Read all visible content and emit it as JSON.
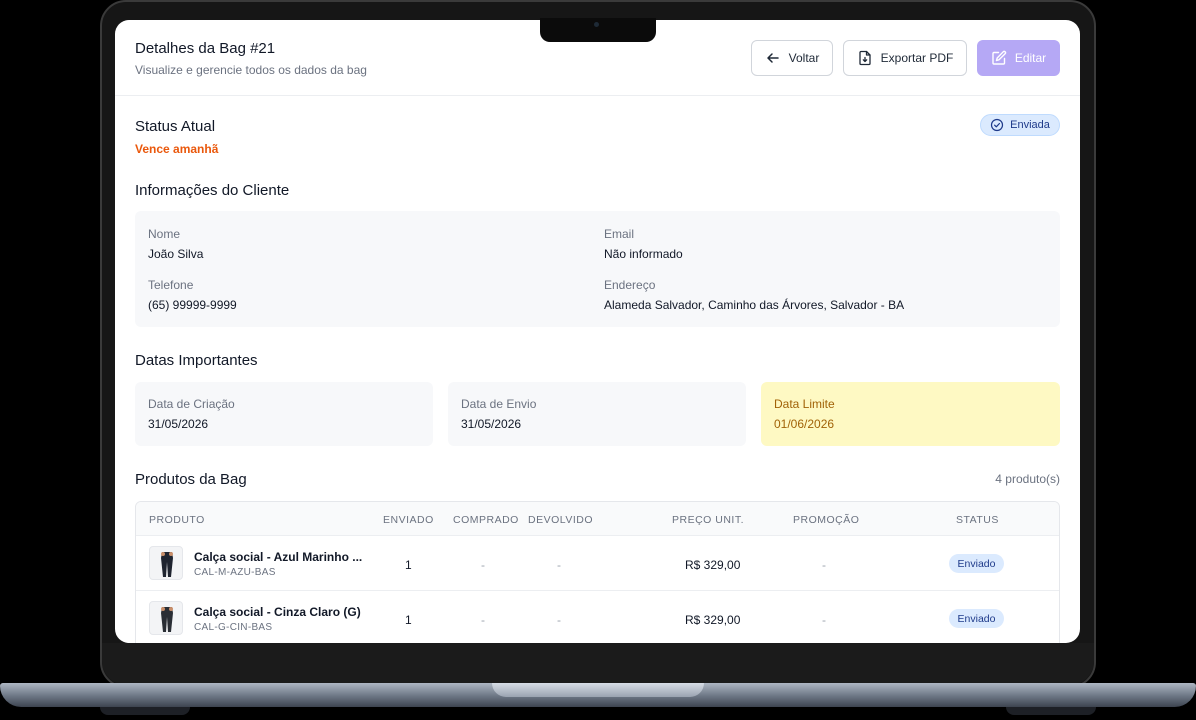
{
  "header": {
    "title": "Detalhes da Bag #21",
    "subtitle": "Visualize e gerencie todos os dados da bag",
    "back_label": "Voltar",
    "export_label": "Exportar PDF",
    "edit_label": "Editar"
  },
  "status": {
    "title": "Status Atual",
    "warning": "Vence amanhã",
    "badge": "Enviada"
  },
  "client": {
    "title": "Informações do Cliente",
    "name_label": "Nome",
    "name": "João Silva",
    "email_label": "Email",
    "email": "Não informado",
    "phone_label": "Telefone",
    "phone": "(65) 99999-9999",
    "address_label": "Endereço",
    "address": "Alameda Salvador, Caminho das Árvores, Salvador - BA"
  },
  "dates": {
    "title": "Datas Importantes",
    "created_label": "Data de Criação",
    "created": "31/05/2026",
    "sent_label": "Data de Envio",
    "sent": "31/05/2026",
    "limit_label": "Data Limite",
    "limit": "01/06/2026"
  },
  "products": {
    "title": "Produtos da Bag",
    "count": "4 produto(s)",
    "columns": [
      "PRODUTO",
      "ENVIADO",
      "COMPRADO",
      "DEVOLVIDO",
      "PREÇO UNIT.",
      "PROMOÇÃO",
      "STATUS"
    ],
    "rows": [
      {
        "name": "Calça social - Azul Marinho ...",
        "sku": "CAL-M-AZU-BAS",
        "sent": "1",
        "bought": "-",
        "returned": "-",
        "price": "R$ 329,00",
        "promo": "-",
        "status": "Enviado"
      },
      {
        "name": "Calça social - Cinza Claro (G)",
        "sku": "CAL-G-CIN-BAS",
        "sent": "1",
        "bought": "-",
        "returned": "-",
        "price": "R$ 329,00",
        "promo": "-",
        "status": "Enviado"
      }
    ]
  },
  "colors": {
    "accent": "#b5a8f5",
    "warning": "#ea580c",
    "status_badge_bg": "#dbeafe",
    "date_limit_bg": "#fef9c3"
  },
  "icons": [
    "arrow-left-icon",
    "file-download-icon",
    "edit-icon",
    "check-circle-icon",
    "pants-thumbnail-icon"
  ]
}
